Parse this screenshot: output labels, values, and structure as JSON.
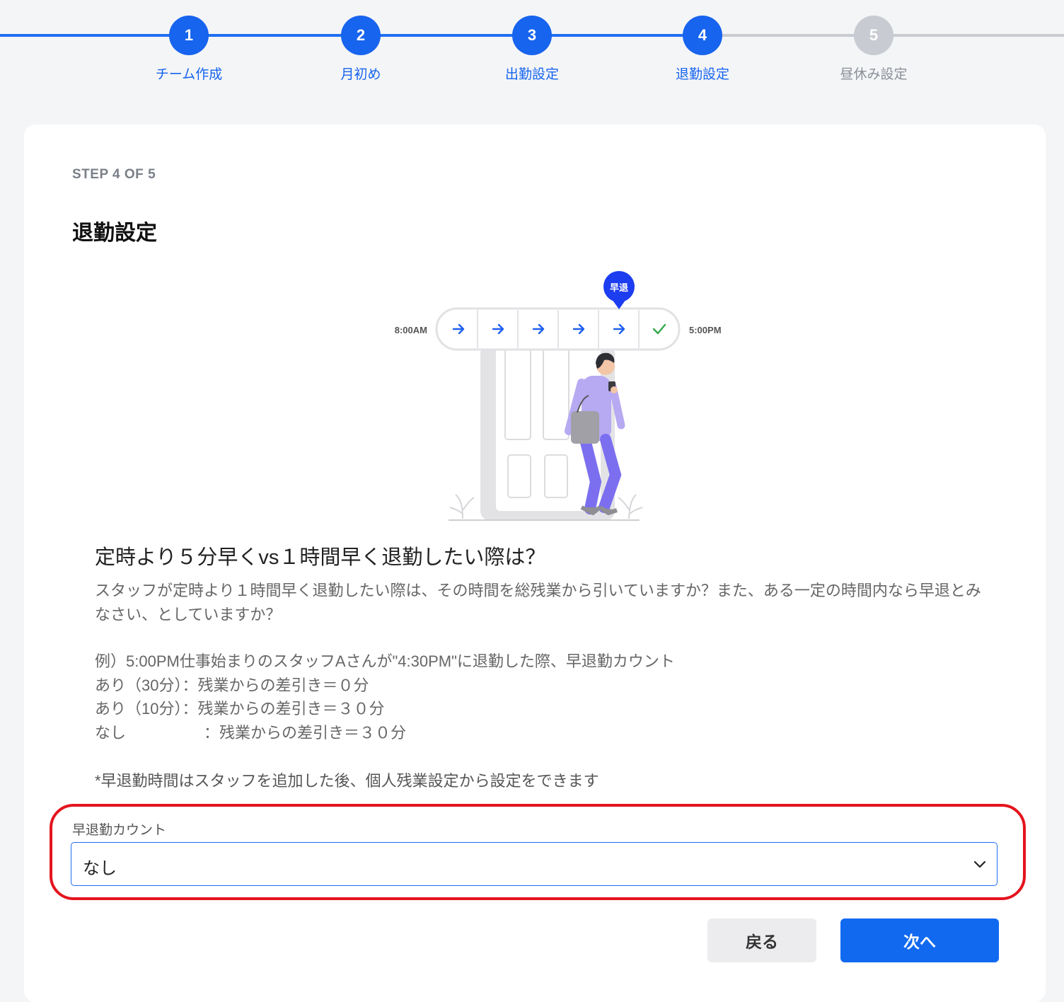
{
  "stepper": {
    "steps": [
      {
        "number": "1",
        "label": "チーム作成"
      },
      {
        "number": "2",
        "label": "月初め"
      },
      {
        "number": "3",
        "label": "出勤設定"
      },
      {
        "number": "4",
        "label": "退勤設定"
      },
      {
        "number": "5",
        "label": "昼休み設定"
      }
    ],
    "current_step": 4
  },
  "card": {
    "step_indicator": "STEP 4 OF 5",
    "title": "退勤設定"
  },
  "illustration": {
    "start_time": "8:00AM",
    "end_time": "5:00PM",
    "pin_label": "早退"
  },
  "question": {
    "title": "定時より５分早くvs１時間早く退勤したい際は？",
    "description": "スタッフが定時より１時間早く退勤したい際は、その時間を総残業から引いていますか？また、ある一定の時間内なら早退とみなさい、としていますか？",
    "example_lines": [
      "例）5:00PM仕事始まりのスタッフAさんが\"4:30PM\"に退勤した際、早退勤カウント",
      "あり（30分）：残業からの差引き＝０分",
      "あり（10分）：残業からの差引き＝３０分",
      "なし　　　　　：残業からの差引き＝３０分"
    ],
    "note": "*早退勤時間はスタッフを追加した後、個人残業設定から設定をできます"
  },
  "field": {
    "label": "早退勤カウント",
    "value": "なし"
  },
  "buttons": {
    "back": "戻る",
    "next": "次へ"
  },
  "colors": {
    "primary": "#1764ee",
    "inactive": "#c8cbd1",
    "highlight": "#e4141e"
  }
}
